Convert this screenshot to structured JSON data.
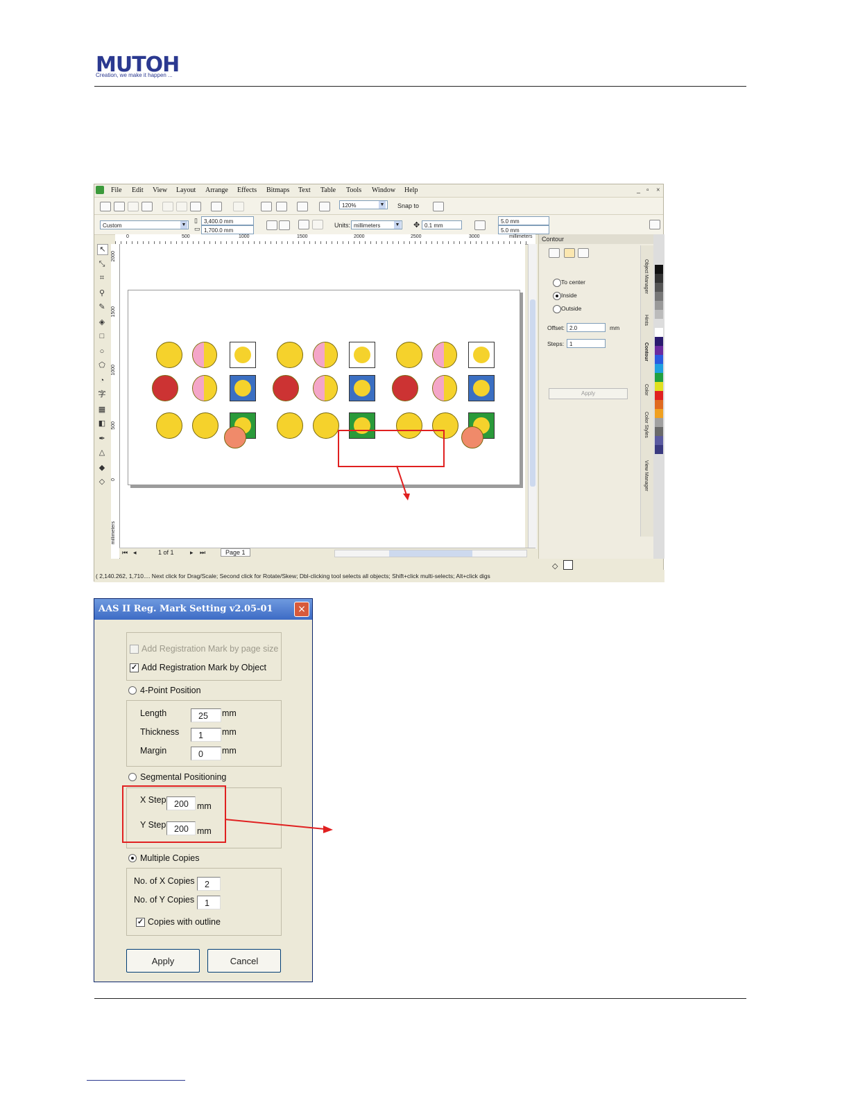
{
  "header": {
    "logo": "MUTOH",
    "tagline": "Creation, we make it happen ..."
  },
  "corel": {
    "menu": [
      "File",
      "Edit",
      "View",
      "Layout",
      "Arrange",
      "Effects",
      "Bitmaps",
      "Text",
      "Table",
      "Tools",
      "Window",
      "Help"
    ],
    "window_controls": [
      "_",
      "▫",
      "×"
    ],
    "zoom": "120%",
    "snap_to": "Snap to",
    "page_preset": "Custom",
    "page_width": "3,400.0 mm",
    "page_height": "1,700.0 mm",
    "units_label": "Units:",
    "units_value": "millimeters",
    "nudge": "0.1 mm",
    "dup_x": "5.0 mm",
    "dup_y": "5.0 mm",
    "ruler_h_ticks": [
      "0",
      "500",
      "1000",
      "1500",
      "2000",
      "2500",
      "3000"
    ],
    "ruler_h_unit": "millimeters",
    "ruler_v_ticks": [
      "2000",
      "1500",
      "1000",
      "500",
      "0"
    ],
    "ruler_v_unit": "millimeters",
    "docker": {
      "title": "Contour",
      "options": [
        "To center",
        "Inside",
        "Outside"
      ],
      "selected": "Inside",
      "offset_label": "Offset:",
      "offset_value": "2.0",
      "offset_unit": "mm",
      "steps_label": "Steps:",
      "steps_value": "1",
      "apply": "Apply",
      "side_tabs": [
        "Object Manager",
        "Hints",
        "Contour",
        "Color",
        "Color Styles",
        "View Manager"
      ]
    },
    "pagebar": {
      "count": "1 of 1",
      "page_tab": "Page 1"
    },
    "status": "( 2,140.262, 1,710.... Next click for Drag/Scale; Second click for Rotate/Skew; Dbl-clicking tool selects all objects; Shift+click multi-selects; Alt+click digs"
  },
  "dialog": {
    "title": "AAS II Reg. Mark Setting v2.05-01",
    "close": "×",
    "opt_page_size": "Add Registration Mark by page size",
    "opt_by_object": "Add Registration Mark by Object",
    "four_point": "4-Point Position",
    "length_label": "Length",
    "length_value": "25",
    "thickness_label": "Thickness",
    "thickness_value": "1",
    "margin_label": "Margin",
    "margin_value": "0",
    "unit": "mm",
    "segmental": "Segmental Positioning",
    "xstep_label": "X Step",
    "xstep_value": "200",
    "ystep_label": "Y Step",
    "ystep_value": "200",
    "multiple": "Multiple Copies",
    "xcopies_label": "No. of X Copies",
    "xcopies_value": "2",
    "ycopies_label": "No. of Y Copies",
    "ycopies_value": "1",
    "outline": "Copies with outline",
    "apply": "Apply",
    "cancel": "Cancel"
  },
  "colors": {
    "brand": "#2b3990",
    "highlight": "#e02020"
  },
  "palette": [
    "#111111",
    "#333333",
    "#555555",
    "#777777",
    "#999999",
    "#bbbbbb",
    "#dddddd",
    "#ffffff",
    "#2a1a6e",
    "#6a2aa0",
    "#2a5ae0",
    "#20a0e0",
    "#20a040",
    "#e0e020",
    "#e02020",
    "#e06a20",
    "#f0a020",
    "#a0a0a0",
    "#6a6a6a",
    "#5a5aa0",
    "#3a3a80"
  ]
}
